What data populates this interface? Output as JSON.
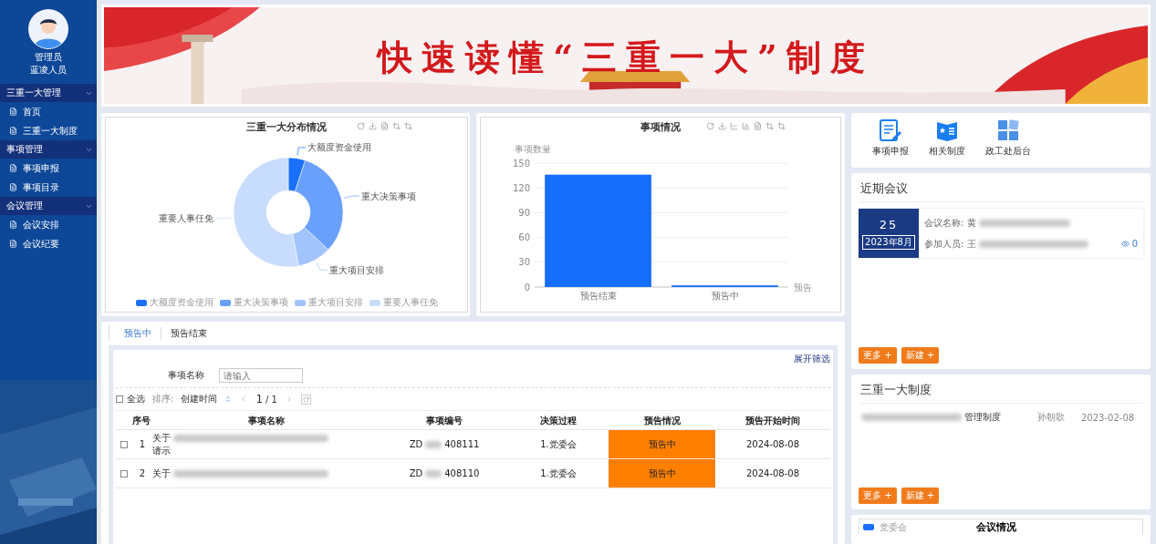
{
  "sidebar": {
    "user": {
      "name": "管理员",
      "role": "蓝凌人员"
    },
    "groups": [
      {
        "label": "三重一大管理",
        "expanded": true,
        "items": [
          {
            "label": "首页",
            "selected": false
          },
          {
            "label": "三重一大制度",
            "selected": false
          }
        ]
      },
      {
        "label": "事项管理",
        "expanded": true,
        "items": [
          {
            "label": "事项申报",
            "selected": false
          },
          {
            "label": "事项目录",
            "selected": false
          }
        ]
      },
      {
        "label": "会议管理",
        "expanded": true,
        "items": [
          {
            "label": "会议安排",
            "selected": false
          },
          {
            "label": "会议纪要",
            "selected": false
          }
        ]
      }
    ]
  },
  "banner": {
    "title": "快速读懂“三重一大”制度"
  },
  "distribution": {
    "title": "三重一大分布情况",
    "labels": [
      "大额度资金使用",
      "重大决策事项",
      "重大项目安排",
      "重要人事任免"
    ],
    "legend": [
      "大额度资金使用",
      "重大决策事项",
      "重大项目安排",
      "重要人事任免"
    ]
  },
  "matters": {
    "chart_data": {
      "type": "bar",
      "title": "事项情况",
      "ylabel": "事项数量",
      "xlabel": "预告",
      "categories": [
        "预告结束",
        "预告中"
      ],
      "values": [
        136,
        2
      ],
      "ylim": [
        0,
        150
      ],
      "yticks": [
        0,
        30,
        60,
        90,
        120,
        150
      ],
      "grid": true
    }
  },
  "list": {
    "tabs": [
      {
        "label": "预告中",
        "selected": true
      },
      {
        "label": "预告结束",
        "selected": false
      }
    ],
    "expand_filter": "展开筛选",
    "filter": {
      "label": "事项名称",
      "placeholder": "请输入"
    },
    "toolbar": {
      "select_all": "全选",
      "select_all_checked": false,
      "sort_label": "排序:",
      "sort_field": "创建时间",
      "page": "1",
      "pages": "/ 1"
    },
    "columns": [
      "序号",
      "事项名称",
      "事项编号",
      "决策过程",
      "预告情况",
      "预告开始时间"
    ],
    "rows": [
      {
        "checked": false,
        "index": "1",
        "name": "关于",
        "name_line2": "请示",
        "code_prefix": "ZD",
        "code_suffix": "408111",
        "process": "1.党委会",
        "status": "预告中",
        "start": "2024-08-08"
      },
      {
        "checked": false,
        "index": "2",
        "name": "关于",
        "code_prefix": "ZD",
        "code_suffix": "408110",
        "process": "1.党委会",
        "status": "预告中",
        "start": "2024-08-08"
      }
    ]
  },
  "shortcuts": [
    {
      "label": "事项申报",
      "kind": "report"
    },
    {
      "label": "相关制度",
      "kind": "rules"
    },
    {
      "label": "政工处后台",
      "kind": "admin"
    }
  ],
  "meetings": {
    "title": "近期会议",
    "items": [
      {
        "day": "25",
        "month": "2023年8月",
        "name_label": "会议名称:",
        "name": "黄",
        "people_label": "参加人员:",
        "people": "王",
        "views": "0"
      }
    ],
    "buttons": [
      "更多 +",
      "新建 +"
    ]
  },
  "regulations": {
    "title": "三重一大制度",
    "items": [
      {
        "title": "管理制度",
        "author": "孙朝歌",
        "date": "2023-02-08"
      }
    ],
    "buttons": [
      "更多 +",
      "新建 +"
    ]
  },
  "meeting_stats": {
    "title": "会议情况",
    "legend": "党委会"
  }
}
